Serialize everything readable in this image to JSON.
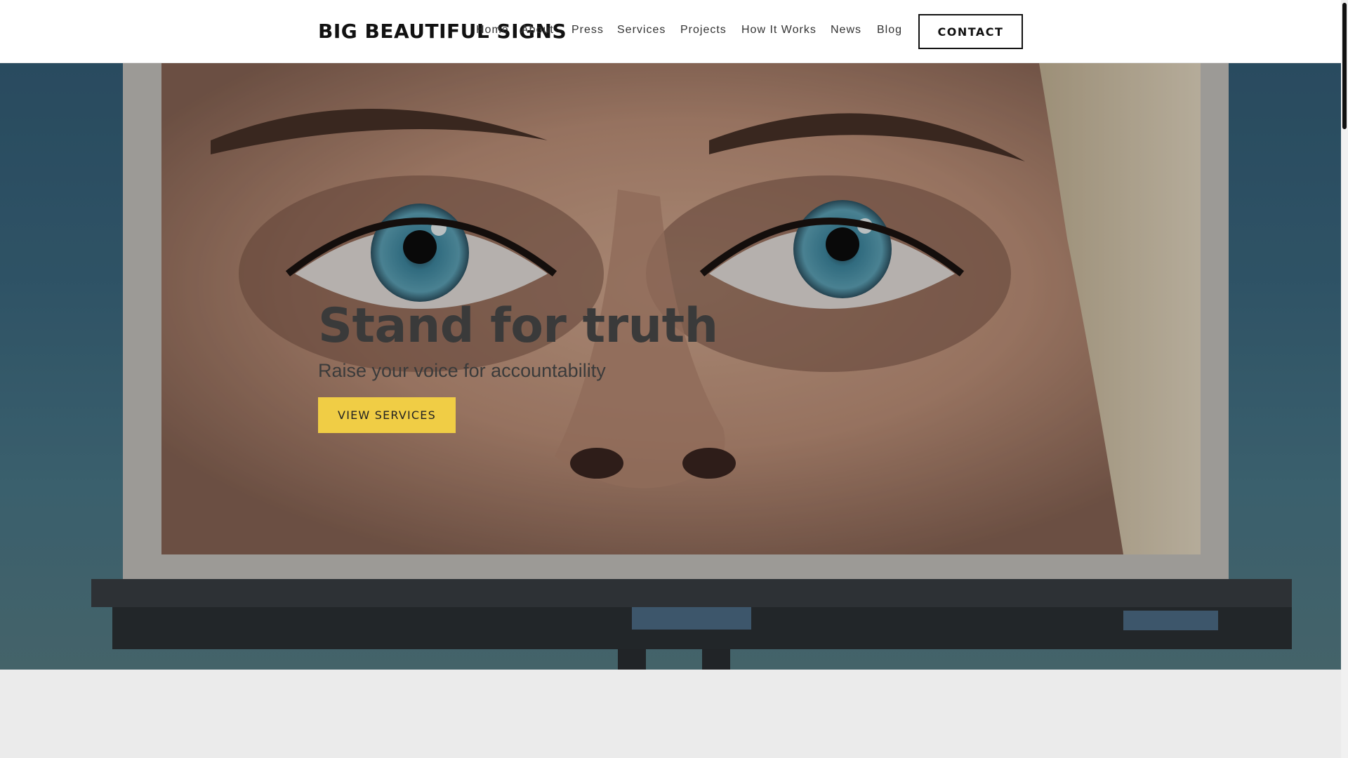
{
  "header": {
    "logo": "BIG BEAUTIFUL SIGNS",
    "nav": [
      {
        "label": "Home"
      },
      {
        "label": "About"
      },
      {
        "label": "Press"
      },
      {
        "label": "Services"
      },
      {
        "label": "Projects"
      },
      {
        "label": "How It Works"
      },
      {
        "label": "News"
      },
      {
        "label": "Blog"
      }
    ],
    "contact_label": "CONTACT"
  },
  "hero": {
    "title": "Stand for truth",
    "subtitle": "Raise your voice for accountability",
    "cta_label": "VIEW SERVICES"
  },
  "colors": {
    "accent": "#f0cd45",
    "header_bg": "#ffffff",
    "page_bg": "#ebebeb"
  }
}
